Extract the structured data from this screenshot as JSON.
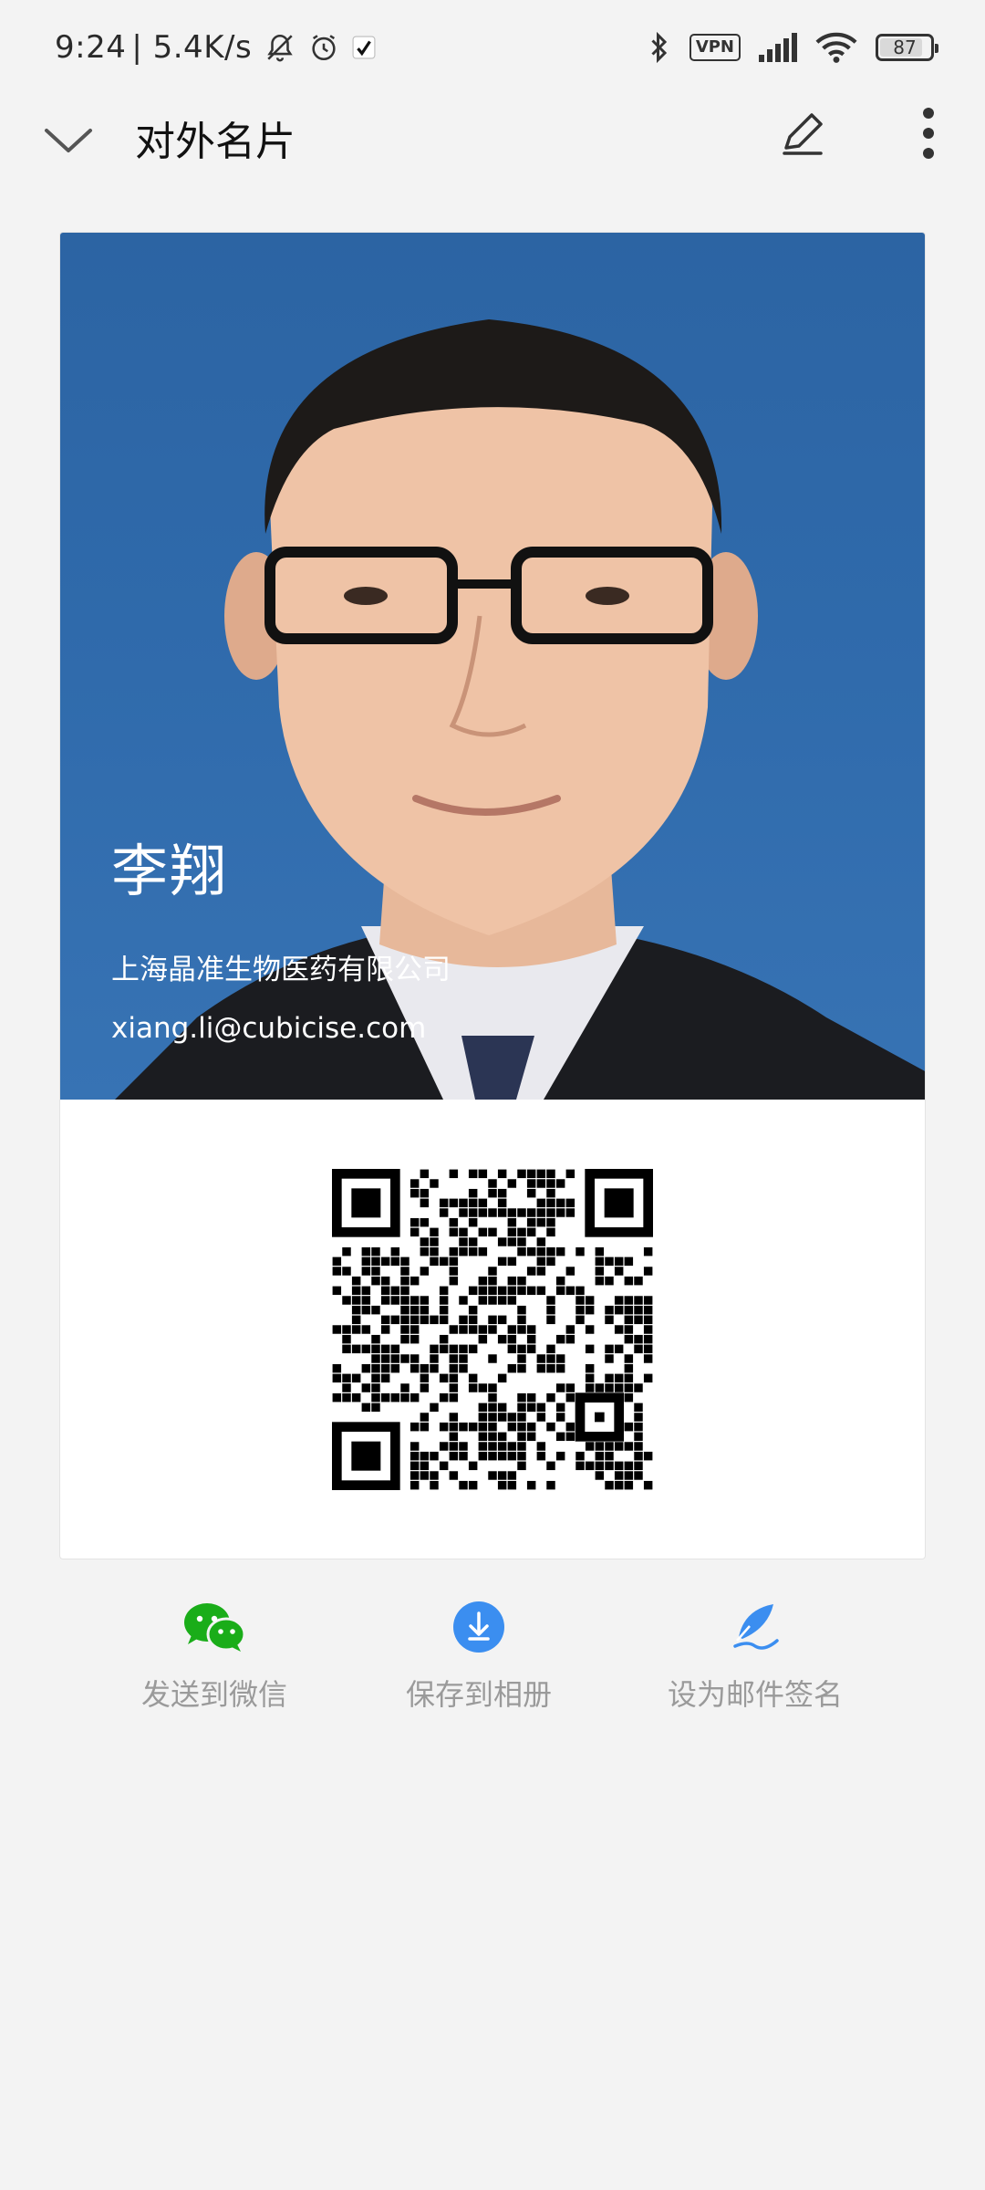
{
  "status_bar": {
    "time": "9:24",
    "net_speed": "| 5.4K/s",
    "vpn": "VPN",
    "battery": "87",
    "battery_level_percent": 87,
    "icons": [
      "mute-bell-icon",
      "alarm-icon",
      "app-notification-icon",
      "bluetooth-icon",
      "vpn-icon",
      "signal-icon",
      "wifi-icon",
      "battery-icon"
    ]
  },
  "header": {
    "title": "对外名片",
    "icons": [
      "chevron-down-icon",
      "edit-pencil-icon",
      "more-vertical-icon"
    ]
  },
  "card": {
    "name": "李翔",
    "company": "上海晶准生物医药有限公司",
    "email": "xiang.li@cubicise.com",
    "colors": {
      "photo_background": "#2f6aab",
      "text": "#ffffff"
    }
  },
  "actions": [
    {
      "label": "发送到微信",
      "icon": "wechat-icon",
      "color": "#1aad19"
    },
    {
      "label": "保存到相册",
      "icon": "download-icon",
      "color": "#3b8ef0"
    },
    {
      "label": "设为邮件签名",
      "icon": "signature-pen-icon",
      "color": "#3b8ef0"
    }
  ]
}
